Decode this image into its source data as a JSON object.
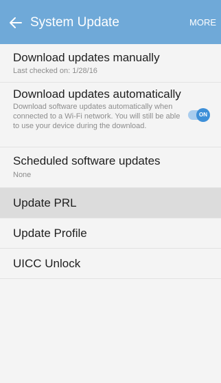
{
  "appbar": {
    "title": "System Update",
    "back_icon": "arrow-left-icon",
    "more_label": "MORE",
    "background": "#6fa9d8"
  },
  "settings": {
    "manual": {
      "title": "Download updates manually",
      "subtitle": "Last checked on: 1/28/16"
    },
    "auto": {
      "title": "Download updates automatically",
      "description": "Download software updates automatically when connected to a Wi-Fi network. You will still be able to use your device during the download.",
      "toggle_label": "ON",
      "toggle_state": true,
      "accent": "#3d8fd8"
    },
    "scheduled": {
      "title": "Scheduled software updates",
      "subtitle": "None"
    },
    "prl": {
      "title": "Update PRL",
      "highlighted": true
    },
    "profile": {
      "title": "Update Profile"
    },
    "uicc": {
      "title": "UICC Unlock"
    }
  }
}
